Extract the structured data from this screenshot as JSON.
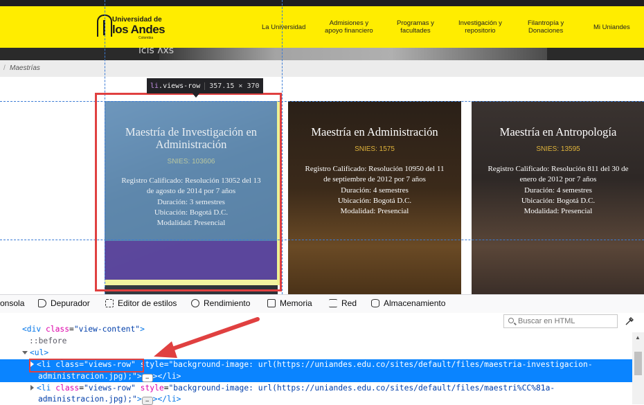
{
  "site": {
    "logo": {
      "line1": "Universidad de",
      "line2": "los Andes",
      "line3": "Colombia"
    },
    "nav": [
      {
        "label": "La Universidad",
        "sub": ""
      },
      {
        "label": "Admisiones y",
        "sub": "apoyo financiero"
      },
      {
        "label": "Programas y",
        "sub": "facultades"
      },
      {
        "label": "Investigación y",
        "sub": "repositorio"
      },
      {
        "label": "Filantropía y",
        "sub": "Donaciones"
      },
      {
        "label": "Mi Uniandes",
        "sub": ""
      }
    ],
    "hero_text": "ıcıs   ʌхs",
    "breadcrumb": {
      "separator": "/",
      "current": "Maestrías"
    }
  },
  "cards": [
    {
      "title": "Maestría de Investigación en Administración",
      "snies": "SNIES: 103606",
      "lines": [
        "Registro Calificado: Resolución 13052 del 13",
        "de agosto de 2014 por 7 años",
        "Duración: 3 semestres",
        "Ubicación: Bogotá D.C.",
        "Modalidad: Presencial"
      ],
      "bg": "#3d4a55"
    },
    {
      "title": "Maestría en Administración",
      "snies": "SNIES: 1575",
      "lines": [
        "Registro Calificado: Resolución 10950 del 11",
        "de septiembre de 2012 por 7 años",
        "Duración: 4 semestres",
        "Ubicación: Bogotá D.C.",
        "Modalidad: Presencial"
      ],
      "bg": "#3a2a1c"
    },
    {
      "title": "Maestría en Antropología",
      "snies": "SNIES: 13595",
      "lines": [
        "Registro Calificado: Resolución 811 del 30 de",
        "enero de 2012 por 7 años",
        "Duración: 4 semestres",
        "Ubicación: Bogotá D.C.",
        "Modalidad: Presencial"
      ],
      "bg": "#3b3330"
    }
  ],
  "highlighter": {
    "tag": "li",
    "class": ".views-row",
    "dims": "357.15 × 370"
  },
  "devtools": {
    "tabs": [
      "onsola",
      "Depurador",
      "Editor de estilos",
      "Rendimiento",
      "Memoria",
      "Red",
      "Almacenamiento"
    ],
    "search_placeholder": "Buscar en HTML",
    "lines": {
      "l0_open": "<div ",
      "l0_attr": "class",
      "l0_eq": "=",
      "l0_val": "\"view-content\"",
      "l0_close": ">",
      "l1": "::before",
      "l2": "<ul>",
      "sel_tag_open": "<li ",
      "sel_class_attr": "class",
      "sel_class_val": "\"views-row\"",
      "sel_style_attr": " style",
      "sel_style_val": "\"background-image: url(https://uniandes.edu.co/sites/default/files/maestria-investigacion-",
      "sel_style_val2": "administracion.jpg);\"",
      "sel_end": "></li>",
      "next_tag_open": "<li ",
      "next_class_attr": "class",
      "next_class_val": "\"views-row\"",
      "next_style_attr": " style",
      "next_style_val": "\"background-image: url(https://uniandes.edu.co/sites/default/files/maestri%CC%81a-",
      "next_style_val2": "administracion.jpg);\"",
      "next_end": "></li>",
      "ellipsis": "…"
    }
  },
  "colors": {
    "header_yellow": "#ffed00",
    "snies_gold": "#e0b43b",
    "selection_blue": "#0a84ff",
    "annotation_red": "#e04040"
  }
}
